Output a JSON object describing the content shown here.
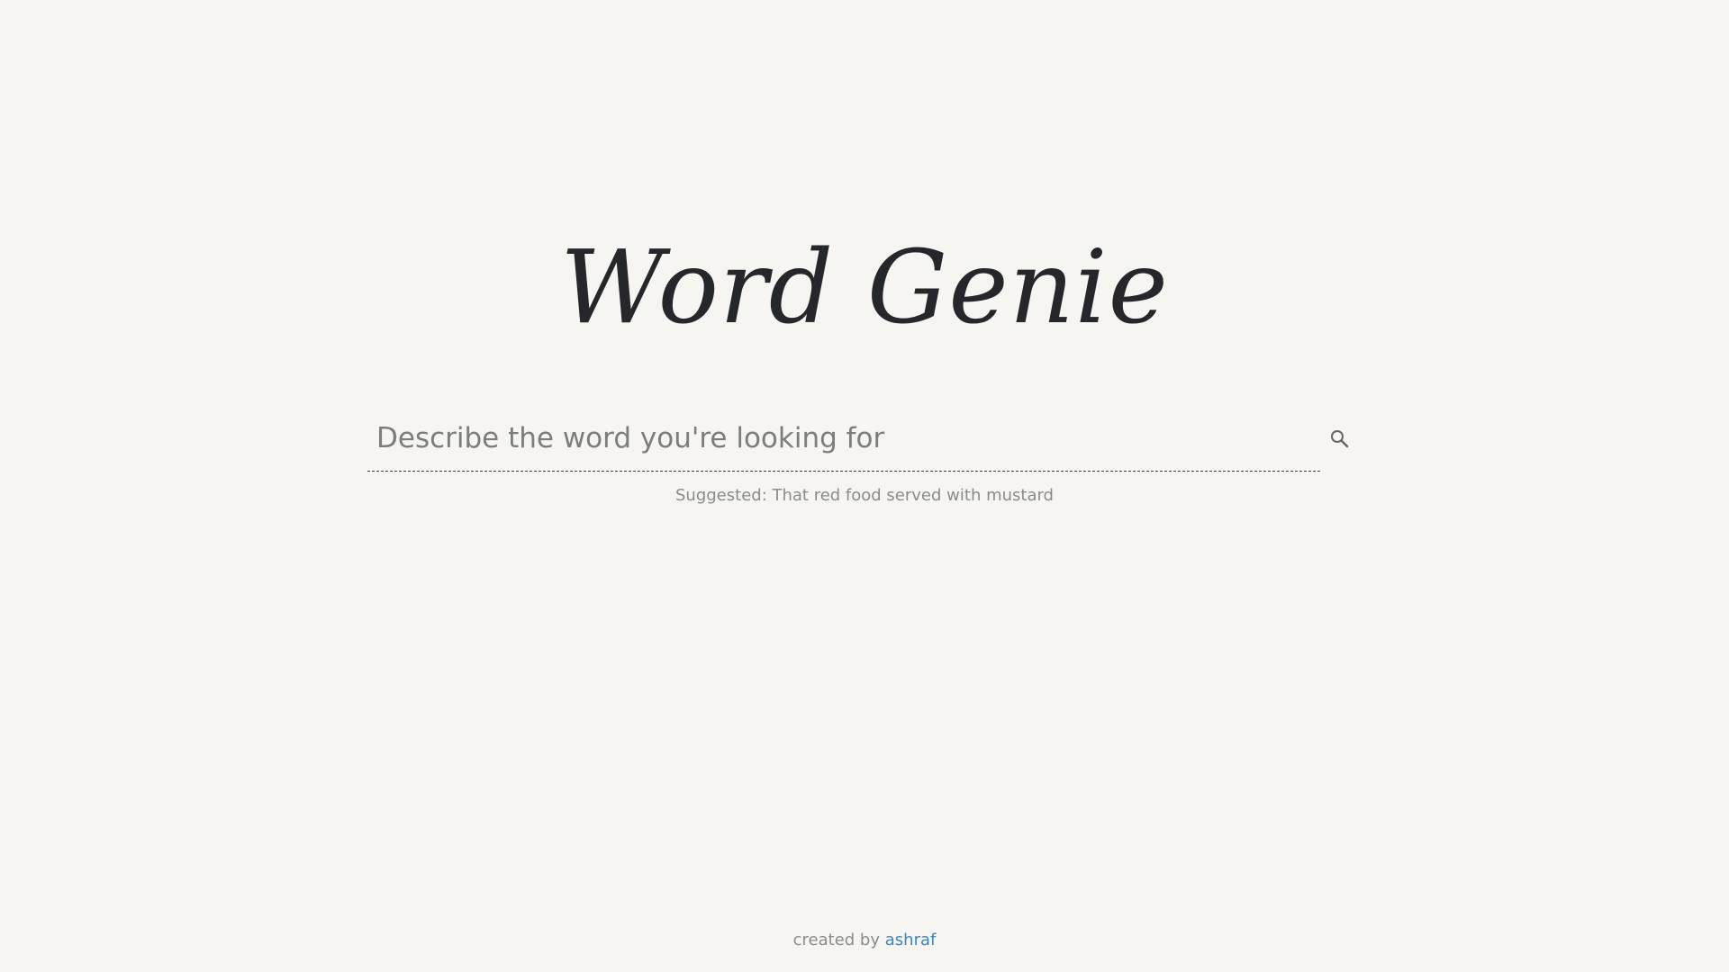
{
  "header": {
    "title": "Word Genie"
  },
  "search": {
    "placeholder": "Describe the word you're looking for",
    "value": "",
    "button_icon": "search-icon"
  },
  "suggestion": {
    "text": "Suggested: That red food served with mustard"
  },
  "footer": {
    "prefix": "created by",
    "author": "ashraf"
  },
  "colors": {
    "background": "#f6f5f2",
    "title": "#26272b",
    "muted_text": "#8b8b8b",
    "link": "#3d86bd"
  }
}
